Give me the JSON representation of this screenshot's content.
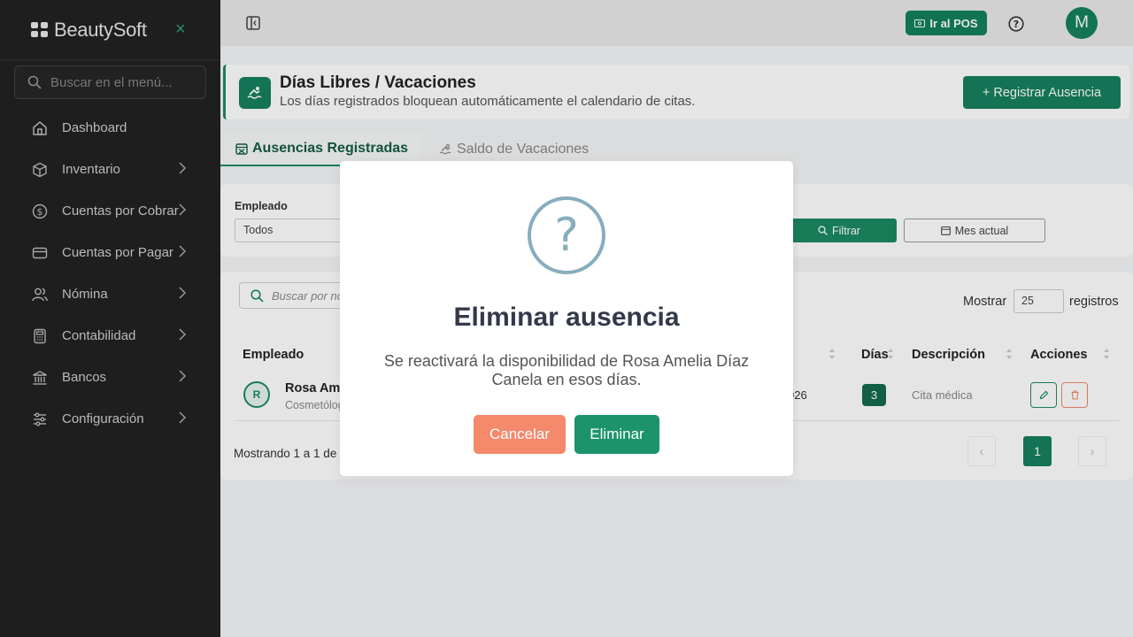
{
  "sidebar": {
    "brand": "BeautySoft",
    "close_icon": "×",
    "search_placeholder": "Buscar en el menú...",
    "items": [
      {
        "label": "Dashboard",
        "icon": "home-icon",
        "has_children": false
      },
      {
        "label": "Inventario",
        "icon": "box-icon",
        "has_children": true
      },
      {
        "label": "Cuentas por Cobrar",
        "icon": "dollar-circle-icon",
        "has_children": true
      },
      {
        "label": "Cuentas por Pagar",
        "icon": "credit-card-icon",
        "has_children": true
      },
      {
        "label": "Nómina",
        "icon": "users-icon",
        "has_children": true
      },
      {
        "label": "Contabilidad",
        "icon": "calculator-icon",
        "has_children": true
      },
      {
        "label": "Bancos",
        "icon": "bank-icon",
        "has_children": true
      },
      {
        "label": "Configuración",
        "icon": "sliders-icon",
        "has_children": true
      }
    ]
  },
  "topbar": {
    "pos_button": "Ir al POS",
    "avatar_initial": "M"
  },
  "page": {
    "title": "Días Libres / Vacaciones",
    "subtitle": "Los días registrados bloquean automáticamente el calendario de citas.",
    "register_button": "+ Registrar Ausencia",
    "icon": "swimmer-icon"
  },
  "tabs": [
    {
      "label": "Ausencias Registradas",
      "active": true
    },
    {
      "label": "Saldo de Vacaciones",
      "active": false
    }
  ],
  "filters": {
    "employee_label": "Empleado",
    "employee_value": "Todos",
    "filter_button": "Filtrar",
    "month_button": "Mes actual"
  },
  "table": {
    "search_placeholder": "Buscar por nombre...",
    "show_label": "Mostrar",
    "show_value": "25",
    "records_label": "registros",
    "headers": [
      "Empleado",
      "Días",
      "Descripción",
      "Acciones"
    ],
    "rows": [
      {
        "initial": "R",
        "name": "Rosa Amelia Díaz Canela",
        "role": "Cosmetóloga",
        "date_fragment": "026",
        "days": "3",
        "description": "Cita médica"
      }
    ],
    "showing_text": "Mostrando 1 a 1 de 1 registros",
    "pagination": {
      "prev": "‹",
      "current": "1",
      "next": "›"
    }
  },
  "modal": {
    "icon_symbol": "?",
    "title": "Eliminar ausencia",
    "text": "Se reactivará la disponibilidad de Rosa Amelia Díaz Canela en esos días.",
    "cancel": "Cancelar",
    "confirm": "Eliminar"
  },
  "colors": {
    "primary": "#17805e",
    "danger": "#f4896b",
    "sidebar_bg": "#222222",
    "modal_icon": "#87adbd"
  }
}
